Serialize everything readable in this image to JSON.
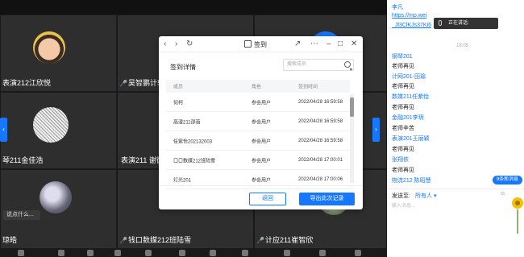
{
  "tiles": [
    {
      "name": "表演212江欣悦"
    },
    {
      "name": "吴智鹏计软"
    },
    {
      "name": "琴211金佳浩"
    },
    {
      "name": "表演211 谢微"
    },
    {
      "name": "琼皓"
    },
    {
      "name": "钱口数媒212班陆雪"
    },
    {
      "name": "计应211崔智欣"
    }
  ],
  "chat_tip": "说点什么...",
  "dialog": {
    "title": "签到",
    "heading": "签到详情",
    "search_placeholder": "搜索成员",
    "columns": {
      "member": "成员",
      "role": "角色",
      "time": "签到时间"
    },
    "rows": [
      {
        "member": "何柯",
        "role": "参会用户",
        "time": "2022/04/28 16:59:58"
      },
      {
        "member": "高漫211邵蓓",
        "role": "参会用户",
        "time": "2022/04/28 16:59:58"
      },
      {
        "member": "任紫怡202132003",
        "role": "参会用户",
        "time": "2022/04/28 16:59:58"
      },
      {
        "member": "口口数媒212班陆雪",
        "role": "参会用户",
        "time": "2022/04/28 17:00:01"
      },
      {
        "member": "灯光201",
        "role": "参会用户",
        "time": "2022/04/28 17:00:06"
      }
    ],
    "return_label": "返回",
    "export_label": "导出此次记录"
  },
  "chat": {
    "user0": "李凡",
    "link0": "https://mp.wei",
    "link1": "_Jl3ClKJs37Ki6",
    "speaking": "正在讲话:",
    "time": "18:05",
    "lines": [
      {
        "type": "user",
        "text": "钢琴201"
      },
      {
        "type": "msg",
        "text": "老师再见"
      },
      {
        "type": "user",
        "text": "计网201-田瑜"
      },
      {
        "type": "msg",
        "text": "老师再见"
      },
      {
        "type": "user",
        "text": "数媒211任紫怡"
      },
      {
        "type": "msg",
        "text": "老师再见"
      },
      {
        "type": "user",
        "text": "金融201李玥"
      },
      {
        "type": "msg",
        "text": "老师辛苦"
      },
      {
        "type": "user",
        "text": "表演201王丽颖"
      },
      {
        "type": "msg",
        "text": "老师再见"
      },
      {
        "type": "user",
        "text": "张翔依"
      },
      {
        "type": "msg",
        "text": "老师再见"
      },
      {
        "type": "user",
        "text": "物流212 陈昭慧"
      }
    ],
    "new_msg": "9条新消息",
    "send_to": "发送至:",
    "send_target": "所有人 ▾",
    "input_placeholder": "输入消息..."
  }
}
